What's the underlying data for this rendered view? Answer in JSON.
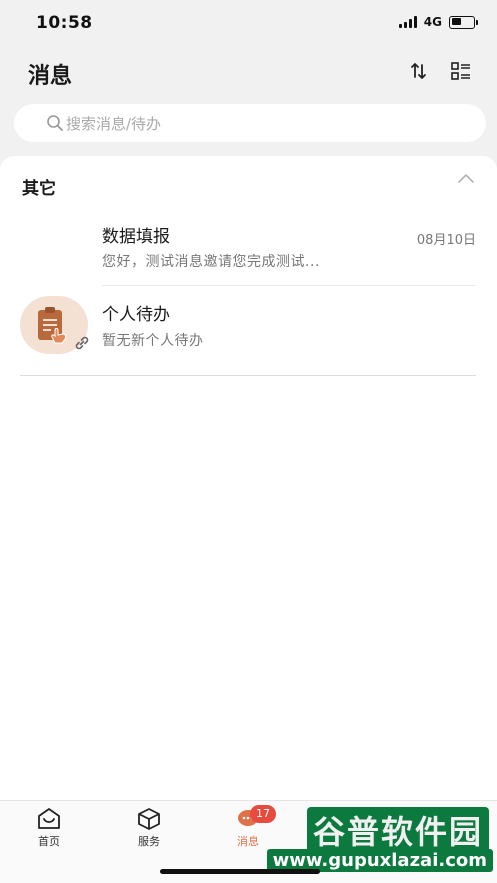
{
  "status_bar": {
    "time": "10:58",
    "network": "4G"
  },
  "header": {
    "title": "消息",
    "sort_icon": "sort-icon",
    "list_icon": "list-icon"
  },
  "search": {
    "placeholder": "搜索消息/待办"
  },
  "section": {
    "title": "其它",
    "collapse_icon": "chevron-up-icon"
  },
  "messages": [
    {
      "title": "数据填报",
      "subtitle": "您好，测试消息邀请您完成测试...",
      "date": "08月10日"
    },
    {
      "title": "个人待办",
      "subtitle": "暂无新个人待办",
      "icon": "clipboard-icon"
    }
  ],
  "bottom_nav": {
    "items": [
      {
        "label": "首页",
        "icon": "home-icon"
      },
      {
        "label": "服务",
        "icon": "cube-icon"
      },
      {
        "label": "消息",
        "icon": "chat-icon",
        "badge": "17",
        "active": true
      },
      {
        "label": "",
        "icon": "calendar-icon"
      },
      {
        "label": "",
        "icon": "user-icon"
      }
    ]
  },
  "watermark": {
    "name": "谷普软件园",
    "url": "www.gupuxlazai.com"
  },
  "colors": {
    "accent": "#e0704a",
    "badge": "#e84a3f",
    "avatar_bg": "#f4e1d4",
    "background_top": "#f1f1f1"
  }
}
